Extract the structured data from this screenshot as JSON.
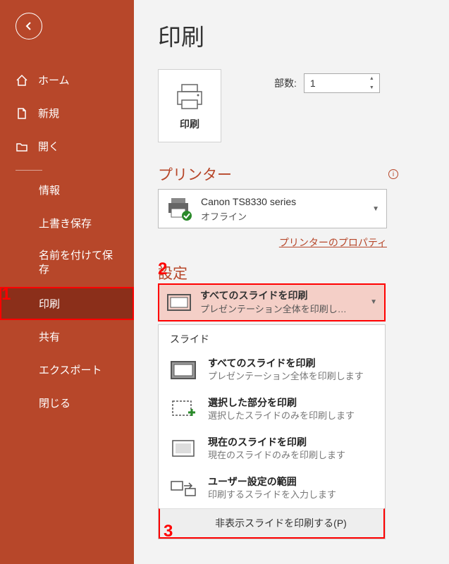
{
  "nav": {
    "home": "ホーム",
    "new": "新規",
    "open": "開く",
    "info": "情報",
    "save": "上書き保存",
    "saveas": "名前を付けて保存",
    "print": "印刷",
    "share": "共有",
    "export": "エクスポート",
    "close": "閉じる"
  },
  "page": {
    "title": "印刷",
    "printBtn": "印刷",
    "copiesLabel": "部数:",
    "copiesValue": "1"
  },
  "printer": {
    "section": "プリンター",
    "name": "Canon TS8330 series",
    "status": "オフライン",
    "propsLink": "プリンターのプロパティ"
  },
  "settings": {
    "section": "設定",
    "ddTitle": "すべてのスライドを印刷",
    "ddSub": "プレゼンテーション全体を印刷し…",
    "menuHeader": "スライド",
    "items": [
      {
        "title": "すべてのスライドを印刷",
        "sub": "プレゼンテーション全体を印刷します"
      },
      {
        "title": "選択した部分を印刷",
        "sub": "選択したスライドのみを印刷します"
      },
      {
        "title": "現在のスライドを印刷",
        "sub": "現在のスライドのみを印刷します"
      },
      {
        "title": "ユーザー設定の範囲",
        "sub": "印刷するスライドを入力します"
      }
    ],
    "footer": "非表示スライドを印刷する(P)"
  },
  "annot": {
    "a1": "1",
    "a2": "2",
    "a3": "3"
  }
}
